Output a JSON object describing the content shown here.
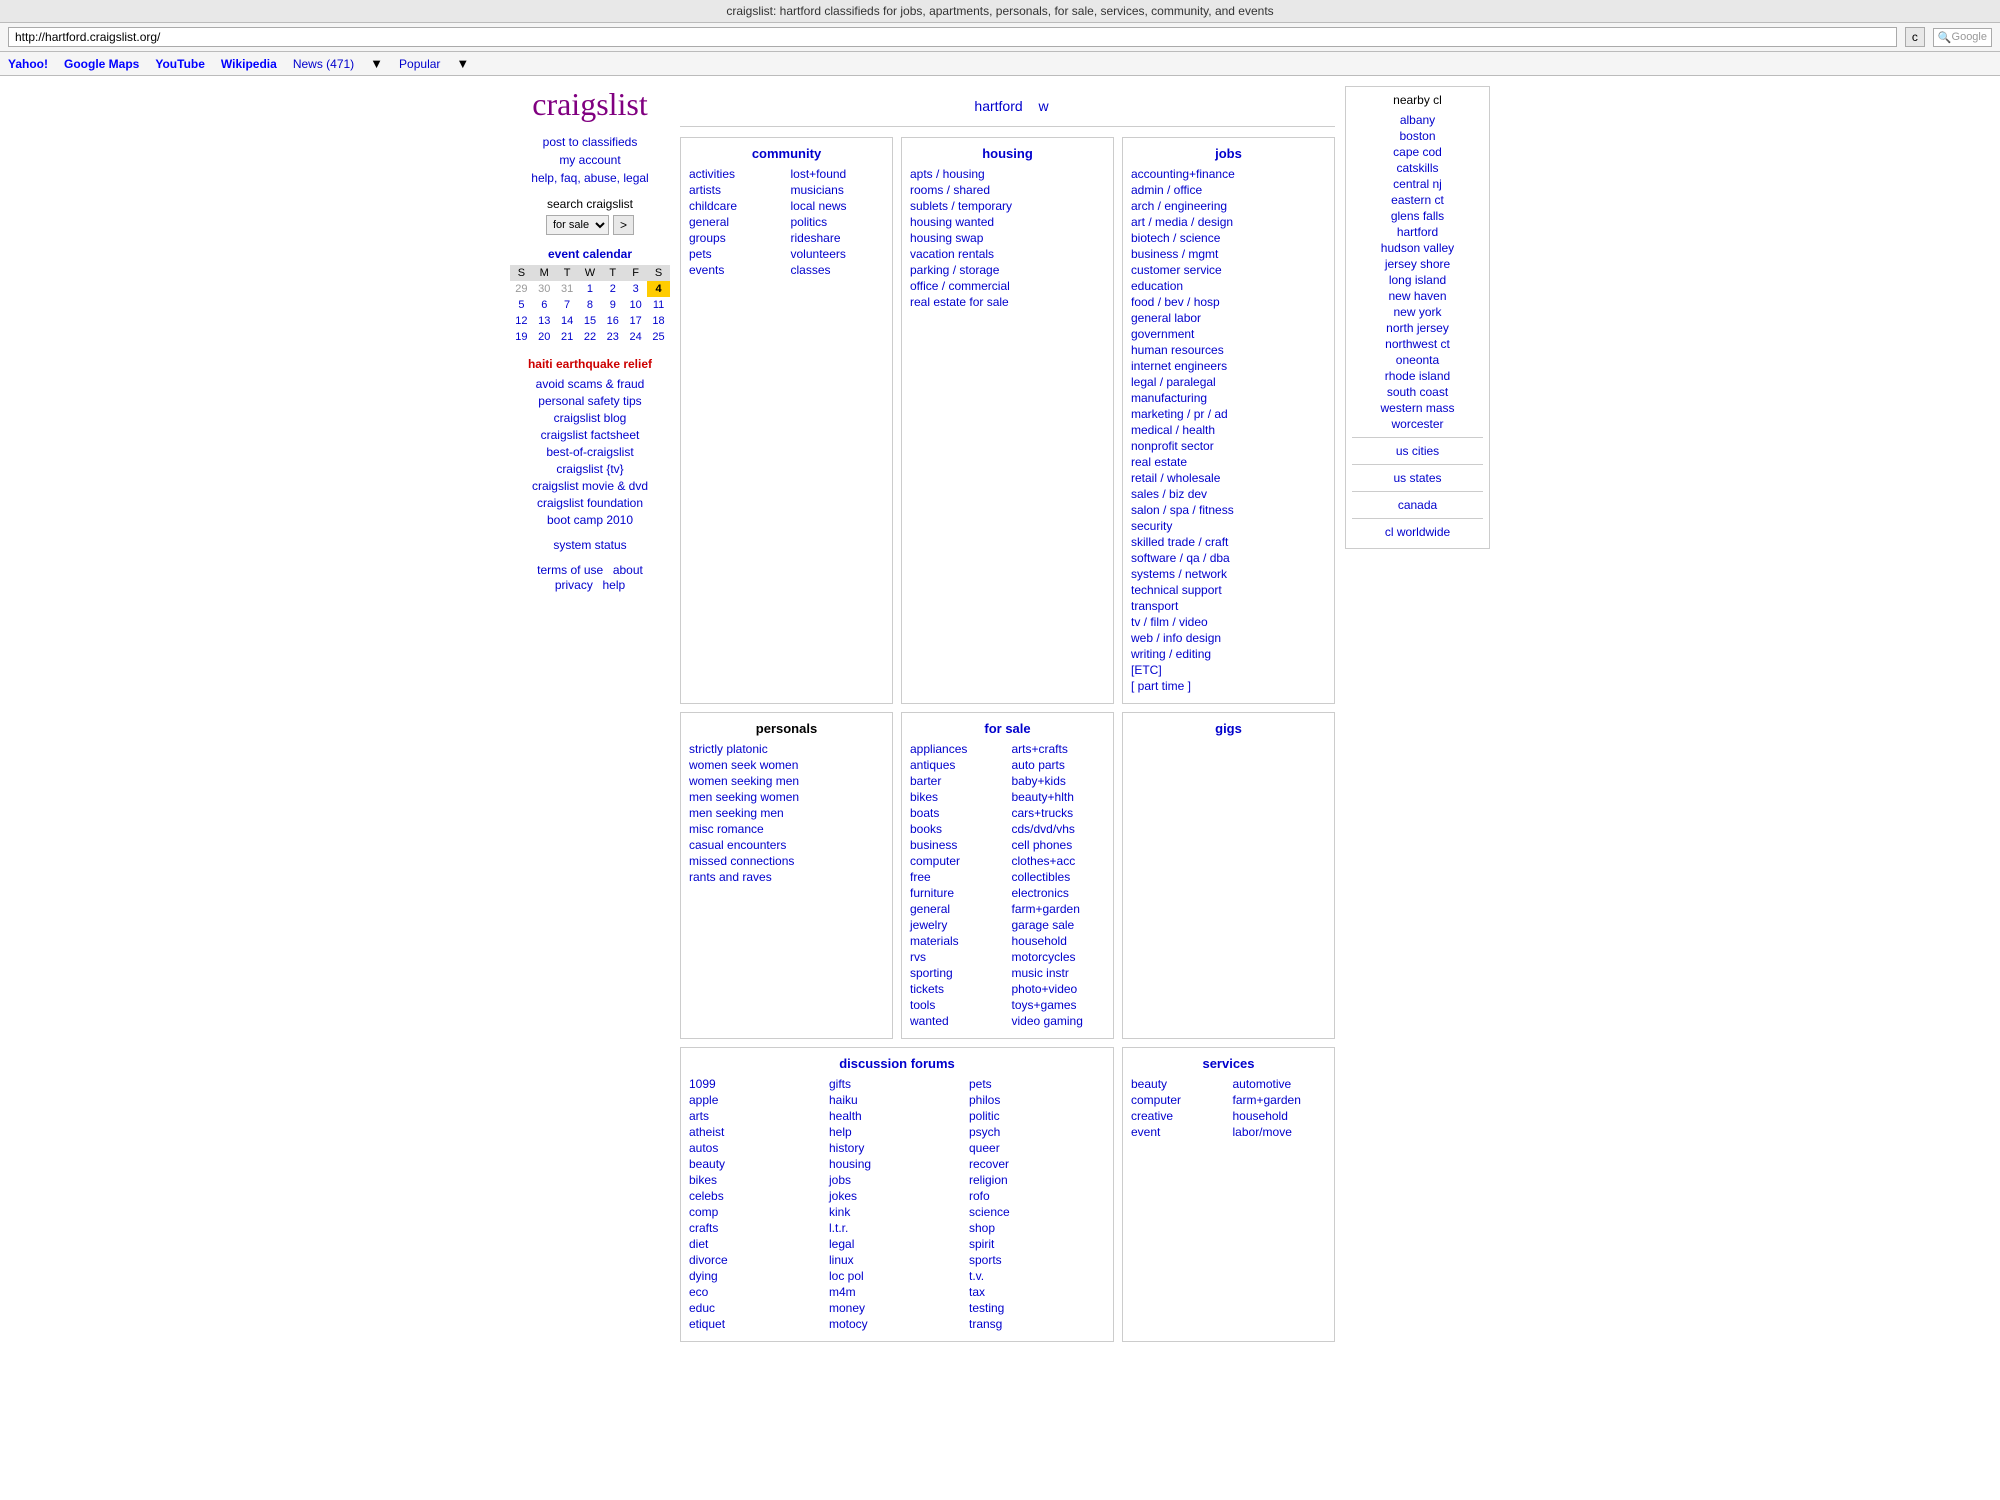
{
  "browser": {
    "title": "craigslist: hartford classifieds for jobs, apartments, personals, for sale, services, community, and events",
    "address": "http://hartford.craigslist.org/",
    "refresh_label": "c",
    "google_placeholder": "Google",
    "bookmarks": [
      {
        "label": "Yahoo!",
        "url": "#"
      },
      {
        "label": "Google Maps",
        "url": "#"
      },
      {
        "label": "YouTube",
        "url": "#"
      },
      {
        "label": "Wikipedia",
        "url": "#"
      },
      {
        "label": "News (471)",
        "url": "#"
      },
      {
        "label": "Popular",
        "url": "#"
      }
    ]
  },
  "sidebar": {
    "logo": "craigslist",
    "links": [
      {
        "label": "post to classifieds",
        "url": "#"
      },
      {
        "label": "my account",
        "url": "#"
      },
      {
        "label": "help, faq, abuse, legal",
        "url": "#"
      }
    ],
    "search_label": "search craigslist",
    "search_placeholder": "for sale",
    "go_label": ">",
    "calendar": {
      "title": "event calendar",
      "headers": [
        "S",
        "M",
        "T",
        "W",
        "T",
        "F",
        "S"
      ],
      "weeks": [
        [
          {
            "day": "29",
            "gray": true
          },
          {
            "day": "30",
            "gray": true
          },
          {
            "day": "31",
            "gray": true
          },
          {
            "day": "1"
          },
          {
            "day": "2"
          },
          {
            "day": "3"
          },
          {
            "day": "4",
            "today": true
          }
        ],
        [
          {
            "day": "5"
          },
          {
            "day": "6"
          },
          {
            "day": "7"
          },
          {
            "day": "8"
          },
          {
            "day": "9"
          },
          {
            "day": "10"
          },
          {
            "day": "11"
          }
        ],
        [
          {
            "day": "12"
          },
          {
            "day": "13"
          },
          {
            "day": "14"
          },
          {
            "day": "15"
          },
          {
            "day": "16"
          },
          {
            "day": "17"
          },
          {
            "day": "18"
          }
        ],
        [
          {
            "day": "19"
          },
          {
            "day": "20"
          },
          {
            "day": "21"
          },
          {
            "day": "22"
          },
          {
            "day": "23"
          },
          {
            "day": "24"
          },
          {
            "day": "25"
          }
        ]
      ]
    },
    "haiti_relief": "haiti earthquake relief",
    "info_links": [
      {
        "label": "avoid scams & fraud"
      },
      {
        "label": "personal safety tips"
      },
      {
        "label": "craigslist blog"
      },
      {
        "label": "craigslist factsheet"
      },
      {
        "label": "best-of-craigslist"
      },
      {
        "label": "craigslist {tv}"
      },
      {
        "label": "craigslist movie & dvd"
      },
      {
        "label": "craigslist foundation"
      },
      {
        "label": "boot camp 2010"
      }
    ],
    "system_status": "system status",
    "bottom_links": [
      {
        "label": "terms of use"
      },
      {
        "label": "about"
      },
      {
        "label": "privacy"
      },
      {
        "label": "help"
      }
    ]
  },
  "main": {
    "city": "hartford",
    "city_link": "w",
    "community": {
      "title": "community",
      "col1": [
        "activities",
        "artists",
        "childcare",
        "general",
        "groups",
        "pets",
        "events"
      ],
      "col2": [
        "lost+found",
        "musicians",
        "local news",
        "politics",
        "rideshare",
        "volunteers",
        "classes"
      ]
    },
    "personals": {
      "title": "personals",
      "links": [
        "strictly platonic",
        "women seek women",
        "women seeking men",
        "men seeking women",
        "men seeking men",
        "misc romance",
        "casual encounters",
        "missed connections",
        "rants and raves"
      ]
    },
    "discussion": {
      "title": "discussion forums",
      "col1": [
        "1099",
        "apple",
        "arts",
        "atheist",
        "autos",
        "beauty",
        "bikes",
        "celebs",
        "comp",
        "crafts",
        "diet",
        "divorce",
        "dying",
        "eco",
        "educ",
        "etiquet"
      ],
      "col2": [
        "gifts",
        "haiku",
        "health",
        "help",
        "history",
        "housing",
        "jobs",
        "jokes",
        "kink",
        "l.t.r.",
        "legal",
        "linux",
        "loc pol",
        "m4m",
        "money",
        "motocy"
      ],
      "col3": [
        "pets",
        "philos",
        "politic",
        "psych",
        "queer",
        "recover",
        "religion",
        "rofo",
        "science",
        "shop",
        "spirit",
        "sports",
        "t.v.",
        "tax",
        "testing",
        "transg"
      ]
    },
    "housing": {
      "title": "housing",
      "links": [
        "apts / housing",
        "rooms / shared",
        "sublets / temporary",
        "housing wanted",
        "housing swap",
        "vacation rentals",
        "parking / storage",
        "office / commercial",
        "real estate for sale"
      ]
    },
    "for_sale": {
      "title": "for sale",
      "col1": [
        "appliances",
        "antiques",
        "barter",
        "bikes",
        "boats",
        "books",
        "business",
        "computer",
        "free",
        "furniture",
        "general",
        "jewelry",
        "materials",
        "rvs",
        "sporting",
        "tickets",
        "tools",
        "wanted"
      ],
      "col2": [
        "arts+crafts",
        "auto parts",
        "baby+kids",
        "beauty+hlth",
        "cars+trucks",
        "cds/dvd/vhs",
        "cell phones",
        "clothes+acc",
        "collectibles",
        "electronics",
        "farm+garden",
        "garage sale",
        "household",
        "motorcycles",
        "music instr",
        "photo+video",
        "toys+games",
        "video gaming"
      ]
    },
    "services": {
      "title": "services",
      "col1": [
        "beauty",
        "computer",
        "creative",
        "event"
      ],
      "col2": [
        "automotive",
        "farm+garden",
        "household",
        "labor/move"
      ]
    },
    "jobs": {
      "title": "jobs",
      "links": [
        "accounting+finance",
        "admin / office",
        "arch / engineering",
        "art / media / design",
        "biotech / science",
        "business / mgmt",
        "customer service",
        "education",
        "food / bev / hosp",
        "general labor",
        "government",
        "human resources",
        "internet engineers",
        "legal / paralegal",
        "manufacturing",
        "marketing / pr / ad",
        "medical / health",
        "nonprofit sector",
        "real estate",
        "retail / wholesale",
        "sales / biz dev",
        "salon / spa / fitness",
        "security",
        "skilled trade / craft",
        "software / qa / dba",
        "systems / network",
        "technical support",
        "transport",
        "tv / film / video",
        "web / info design",
        "writing / editing",
        "[ETC]",
        "[ part time ]"
      ]
    },
    "gigs": {
      "title": "gigs"
    }
  },
  "nearby": {
    "title": "nearby cl",
    "links": [
      "albany",
      "boston",
      "cape cod",
      "catskills",
      "central nj",
      "eastern ct",
      "glens falls",
      "hartford",
      "hudson valley",
      "jersey shore",
      "long island",
      "new haven",
      "new york",
      "north jersey",
      "northwest ct",
      "oneonta",
      "rhode island",
      "south coast",
      "western mass",
      "worcester"
    ],
    "cat_links": [
      "us cities",
      "us states",
      "canada",
      "cl worldwide"
    ]
  }
}
